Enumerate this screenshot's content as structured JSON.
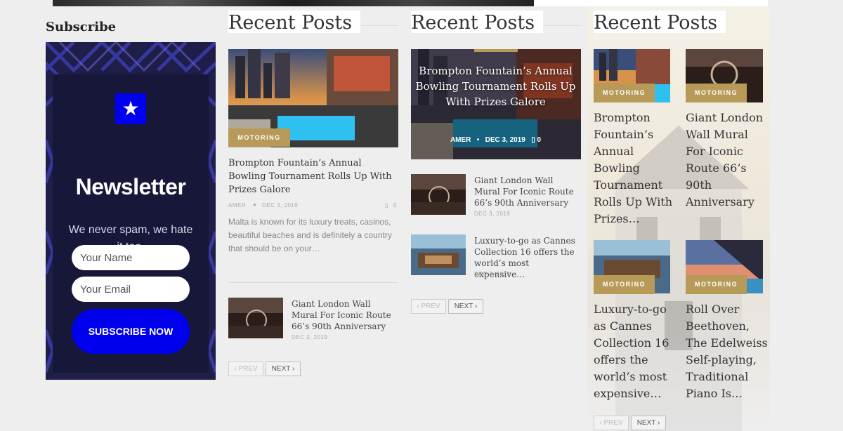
{
  "subscribe": {
    "heading": "Subscribe",
    "newsletter_title": "Newsletter",
    "tagline": "We never spam, we hate it too.",
    "name_placeholder": "Your Name",
    "email_placeholder": "Your Email",
    "button_label": "SUBSCRIBE NOW",
    "accent_color": "#0000ee"
  },
  "col2": {
    "heading": "Recent Posts",
    "featured": {
      "category": "MOTORING",
      "title": "Brompton Fountain’s Annual Bowling Tournament Rolls Up With Prizes Galore",
      "author": "AMER",
      "date": "DEC 3, 2019",
      "comments": "0",
      "excerpt": "Malta is known for its luxury treats, casinos, beautiful beaches and is definitely a country that should be on your…"
    },
    "small_posts": [
      {
        "title": "Giant London Wall Mural For Iconic Route 66’s 90th Anniversary",
        "date": "DEC 3, 2019"
      }
    ],
    "pager": {
      "prev": "PREV",
      "next": "NEXT"
    }
  },
  "col3": {
    "heading": "Recent Posts",
    "featured": {
      "title": "Brompton Fountain’s Annual Bowling Tournament Rolls Up With Prizes Galore",
      "author": "AMER",
      "date": "DEC 3, 2019",
      "comments": "0"
    },
    "small_posts": [
      {
        "title": "Giant London Wall Mural For Iconic Route 66’s 90th Anniversary",
        "date": "DEC 3, 2019"
      },
      {
        "title": "Luxury-to-go as Cannes Collection 16 offers the world’s most expensive…",
        "date": "DEC 3, 2019"
      }
    ],
    "pager": {
      "prev": "PREV",
      "next": "NEXT"
    }
  },
  "col4": {
    "heading": "Recent Posts",
    "posts": [
      {
        "category": "MOTORING",
        "title": "Brompton Fountain’s Annual Bowling Tournament Rolls Up With Prizes…"
      },
      {
        "category": "MOTORING",
        "title": "Giant London Wall Mural For Iconic Route 66’s 90th Anniversary"
      },
      {
        "category": "MOTORING",
        "title": "Luxury-to-go as Cannes Collection 16 offers the world’s most expensive…"
      },
      {
        "category": "MOTORING",
        "title": "Roll Over Beethoven, The Edelweiss Self-playing, Traditional Piano Is…"
      }
    ],
    "pager": {
      "prev": "PREV",
      "next": "NEXT"
    }
  },
  "icons": {
    "star": "star-icon",
    "comment": "comment-icon",
    "chevron_left": "chevron-left-icon",
    "chevron_right": "chevron-right-icon"
  },
  "colors": {
    "badge": "#b89a58",
    "newsletter_bg": "#17173a"
  }
}
